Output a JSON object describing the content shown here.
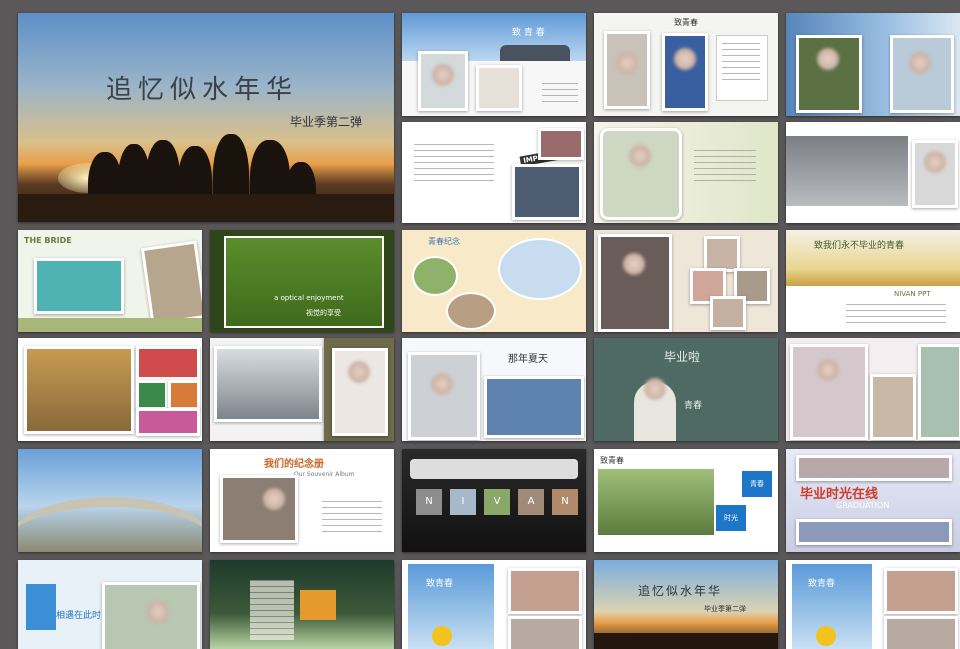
{
  "hero": {
    "title": "追忆似水年华",
    "subtitle": "毕业季第二弹"
  },
  "slides": {
    "slide_2_title": "致 青 春",
    "slide_3_title": "致青春",
    "slide_6_badge": "IMPORTANT",
    "slide_9_brand": "THE BRIDE",
    "slide_10_caption_en": "a optical enjoyment",
    "slide_10_caption_cn": "视觉的享受",
    "slide_11_title": "青春纪念",
    "slide_13_title": "致我们永不毕业的青春",
    "slide_13_sub": "NIVAN PPT",
    "slide_17_title": "那年夏天",
    "slide_18_chalk": "毕业啦",
    "slide_18_label": "青春",
    "slide_22_title": "我们的纪念册",
    "slide_22_sub": "Our Souvenir Album",
    "slide_23_letters": [
      "N",
      "I",
      "V",
      "A",
      "N"
    ],
    "slide_24_title": "致青春",
    "slide_24_tag1": "青春",
    "slide_24_tag2": "时光",
    "slide_25_title": "毕业时光在线",
    "slide_25_sub": "GRADUATION",
    "slide_26_text": "相遇在此时",
    "slide_28_title": "致青春",
    "slide_29_title": "追忆似水年华",
    "slide_29_sub": "毕业季第二弹",
    "slide_30_title": "致青春"
  },
  "colors": {
    "background": "#5a5858",
    "sky": "#7fb0de",
    "sunset": "#e8a04a",
    "chalkboard": "#4f6a62",
    "accent_blue": "#1e76c8",
    "accent_orange": "#e59a2e",
    "accent_red": "#d23a2a",
    "olive": "#a8b779"
  }
}
